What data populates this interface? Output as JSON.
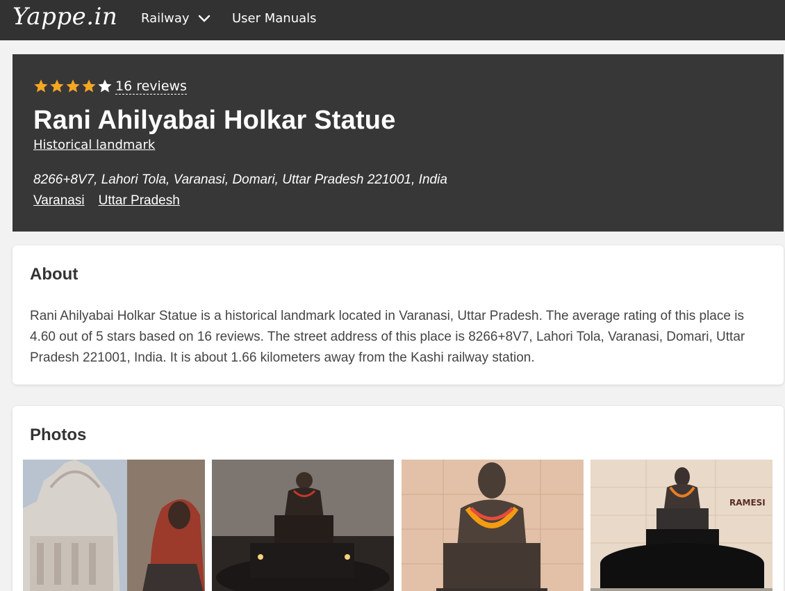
{
  "nav": {
    "logo": "Yappe.in",
    "railway_label": "Railway",
    "manuals_label": "User Manuals"
  },
  "place": {
    "rating": 4.6,
    "reviews_label": "16 reviews",
    "title": "Rani Ahilyabai Holkar Statue",
    "category": "Historical landmark",
    "address": "8266+8V7, Lahori Tola, Varanasi, Domari, Uttar Pradesh 221001, India",
    "city": "Varanasi",
    "state": "Uttar Pradesh"
  },
  "about": {
    "heading": "About",
    "text": "Rani Ahilyabai Holkar Statue is a historical landmark located in Varanasi, Uttar Pradesh. The average rating of this place is 4.60 out of 5 stars based on 16 reviews. The street address of this place is 8266+8V7, Lahori Tola, Varanasi, Domari, Uttar Pradesh 221001, India. It is about 1.66 kilometers away from the Kashi railway station."
  },
  "photos": {
    "heading": "Photos",
    "items": [
      {
        "subject": "temple-and-statue"
      },
      {
        "subject": "statue-at-night"
      },
      {
        "subject": "statue-with-garlands"
      },
      {
        "subject": "statue-on-pedestal",
        "wall_text": "RAMESI"
      }
    ]
  },
  "colors": {
    "nav_bg": "#333232",
    "hero_bg": "#383738",
    "star_fill": "#f5a623",
    "star_empty": "#ffffff",
    "page_bg": "#f2f2f2"
  }
}
